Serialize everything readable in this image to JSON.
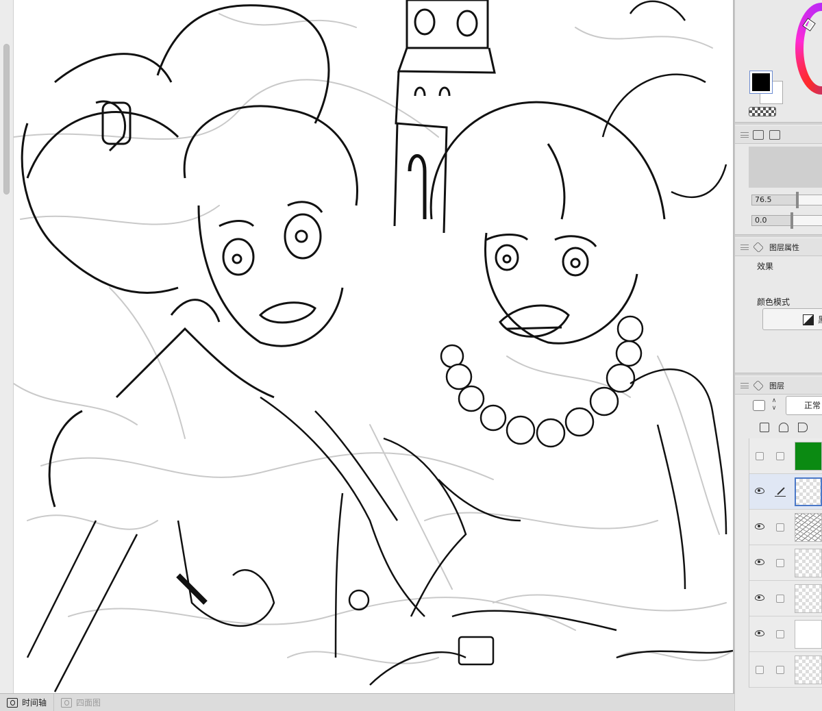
{
  "bottom_tabs": [
    {
      "label": "时间轴",
      "icon": "timeline-icon",
      "active": true
    },
    {
      "label": "四面图",
      "icon": "camera-icon",
      "active": false
    }
  ],
  "color": {
    "foreground": "#000000",
    "background": "#ffffff"
  },
  "panels": {
    "opacity_slider": "76.5",
    "second_slider": "0.0",
    "layer_property": {
      "title": "图层属性",
      "effect_label": "效果",
      "color_mode_label": "颜色模式",
      "color_mode_value": "黑"
    },
    "layers": {
      "title": "图层",
      "blend_mode": "正常",
      "stepper": [
        "∧",
        "∨"
      ],
      "items": [
        {
          "visible": false,
          "thumb": "green",
          "locked_pen": false
        },
        {
          "visible": true,
          "thumb": "checker",
          "locked_pen": true,
          "selected": true
        },
        {
          "visible": true,
          "thumb": "sketch",
          "locked_pen": false
        },
        {
          "visible": true,
          "thumb": "checker",
          "locked_pen": false
        },
        {
          "visible": true,
          "thumb": "checker",
          "locked_pen": false
        },
        {
          "visible": true,
          "thumb": "white",
          "locked_pen": false
        },
        {
          "visible": false,
          "thumb": "checker",
          "locked_pen": false
        }
      ]
    }
  },
  "accent_colors": {
    "selection": "#4a78c8",
    "layer_green": "#0b8a12"
  }
}
